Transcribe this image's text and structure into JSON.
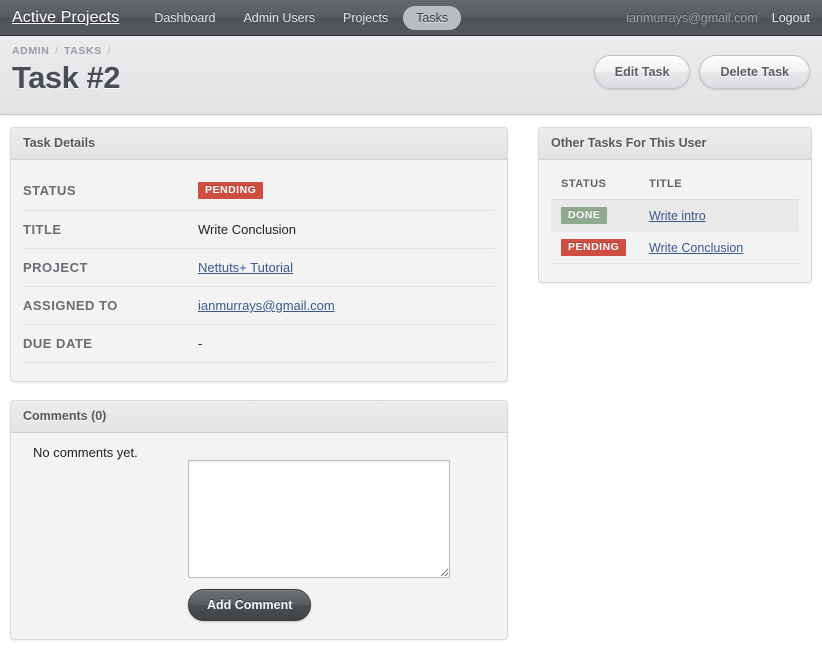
{
  "nav": {
    "brand": "Active Projects",
    "links": [
      {
        "label": "Dashboard",
        "active": false
      },
      {
        "label": "Admin Users",
        "active": false
      },
      {
        "label": "Projects",
        "active": false
      },
      {
        "label": "Tasks",
        "active": true
      }
    ],
    "user_email": "ianmurrays@gmail.com",
    "logout_label": "Logout"
  },
  "subheader": {
    "breadcrumb": [
      "ADMIN",
      "TASKS"
    ],
    "breadcrumb_separator": "/",
    "title": "Task #2",
    "edit_label": "Edit Task",
    "delete_label": "Delete Task"
  },
  "task_details": {
    "panel_title": "Task Details",
    "rows": [
      {
        "label": "STATUS",
        "value": "PENDING",
        "kind": "badge-pending"
      },
      {
        "label": "TITLE",
        "value": "Write Conclusion",
        "kind": "text"
      },
      {
        "label": "PROJECT",
        "value": "Nettuts+ Tutorial",
        "kind": "link"
      },
      {
        "label": "ASSIGNED TO",
        "value": "ianmurrays@gmail.com",
        "kind": "link"
      },
      {
        "label": "DUE DATE",
        "value": "-",
        "kind": "text"
      }
    ]
  },
  "other_tasks": {
    "panel_title": "Other Tasks For This User",
    "columns": [
      "STATUS",
      "TITLE"
    ],
    "rows": [
      {
        "status": "DONE",
        "status_kind": "badge-done",
        "title": "Write intro"
      },
      {
        "status": "PENDING",
        "status_kind": "badge-pending",
        "title": "Write Conclusion"
      }
    ]
  },
  "comments": {
    "panel_title": "Comments (0)",
    "empty_text": "No comments yet.",
    "textarea_value": "",
    "textarea_placeholder": "",
    "submit_label": "Add Comment"
  },
  "colors": {
    "nav_bg": "#585c60",
    "pending": "#ce4e42",
    "done": "#8faa8c",
    "link": "#3b5a8c",
    "panel_bg": "#f3f3f3"
  }
}
